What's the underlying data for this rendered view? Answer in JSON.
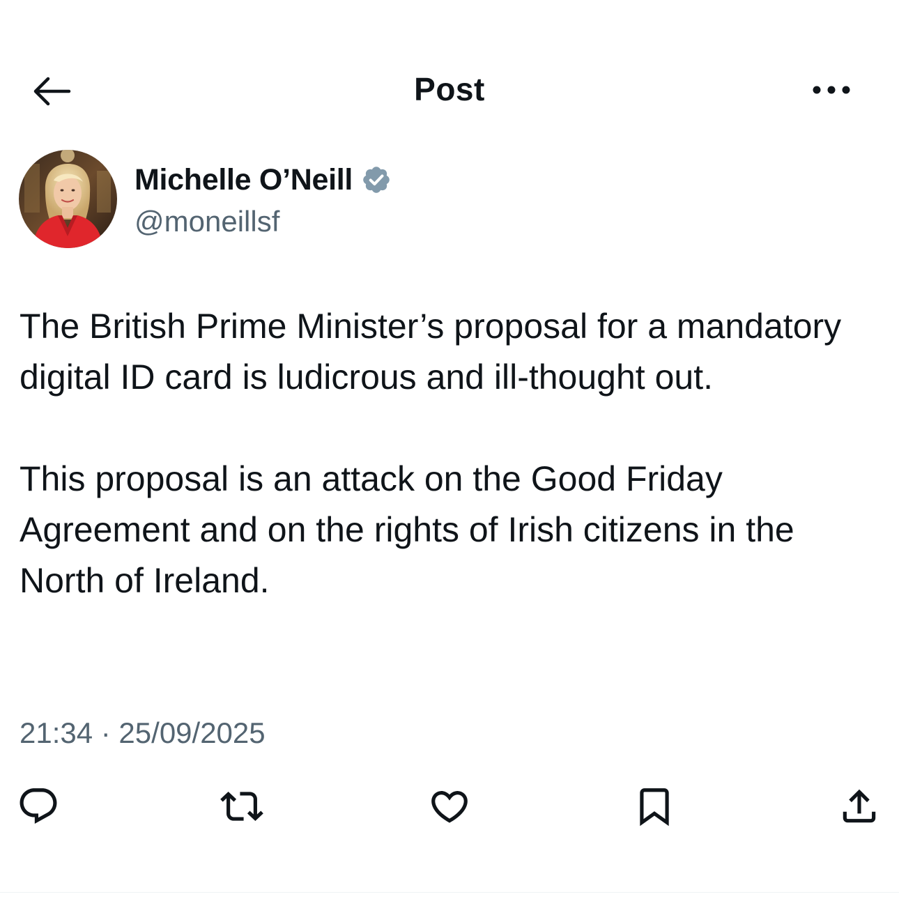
{
  "header": {
    "title": "Post",
    "back_icon": "arrow-left-icon",
    "more_icon": "more-horizontal-icon"
  },
  "author": {
    "name": "Michelle O’Neill",
    "handle": "@moneillsf",
    "verified_icon": "verified-badge-icon",
    "verified_color": "#829aab"
  },
  "post": {
    "paragraphs": [
      "The British Prime Minister’s proposal for a mandatory digital ID card is ludicrous and ill-thought out.",
      "This proposal is an attack on the Good Friday Agreement and on the rights of Irish citizens in the North of Ireland."
    ],
    "timestamp": "21:34 · 25/09/2025"
  },
  "actions": [
    {
      "name": "reply",
      "icon": "reply-icon"
    },
    {
      "name": "repost",
      "icon": "repost-icon"
    },
    {
      "name": "like",
      "icon": "heart-icon"
    },
    {
      "name": "bookmark",
      "icon": "bookmark-icon"
    },
    {
      "name": "share",
      "icon": "share-icon"
    }
  ],
  "colors": {
    "text_primary": "#0f1419",
    "text_secondary": "#536471"
  }
}
